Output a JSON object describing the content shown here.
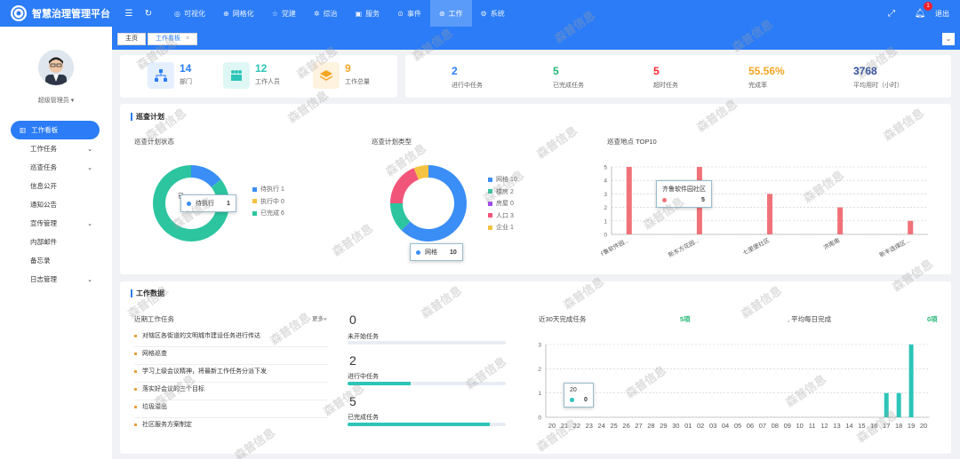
{
  "app": {
    "title": "智慧治理管理平台"
  },
  "nav": [
    {
      "icon": "eye-icon",
      "label": "可视化"
    },
    {
      "icon": "grid-icon",
      "label": "网格化"
    },
    {
      "icon": "star-icon",
      "label": "党建"
    },
    {
      "icon": "settings-icon",
      "label": "综治"
    },
    {
      "icon": "book-icon",
      "label": "服务"
    },
    {
      "icon": "location-icon",
      "label": "事件"
    },
    {
      "icon": "work-icon",
      "label": "工作"
    },
    {
      "icon": "gear-icon",
      "label": "系统"
    }
  ],
  "header": {
    "notification_count": "1",
    "logout": "退出"
  },
  "user": {
    "name": "超级管理员"
  },
  "sidebar": {
    "items": [
      {
        "label": "工作看板"
      },
      {
        "label": "工作任务"
      },
      {
        "label": "巡查任务"
      },
      {
        "label": "信息公开"
      },
      {
        "label": "通知公告"
      },
      {
        "label": "宣传管理"
      },
      {
        "label": "内部邮件"
      },
      {
        "label": "备忘录"
      },
      {
        "label": "日志管理"
      }
    ]
  },
  "tabs": [
    {
      "label": "主页"
    },
    {
      "label": "工作看板"
    }
  ],
  "stats": [
    {
      "value": "14",
      "label": "部门",
      "color": "#2b7cf6"
    },
    {
      "value": "12",
      "label": "工作人员",
      "color": "#2cc5b8"
    },
    {
      "value": "9",
      "label": "工作总量",
      "color": "#f5a623"
    }
  ],
  "kpis": [
    {
      "value": "2",
      "label": "进行中任务",
      "color": "#2b7cf6"
    },
    {
      "value": "5",
      "label": "已完成任务",
      "color": "#22b573"
    },
    {
      "value": "5",
      "label": "超时任务",
      "color": "#f5222d"
    },
    {
      "value": "55.56%",
      "label": "完成率",
      "color": "#f5a623"
    },
    {
      "value": "3768",
      "label": "平均用时（小时）",
      "color": "#2b4a9c"
    }
  ],
  "patrol": {
    "title": "巡查计划",
    "status_title": "巡查计划状态",
    "type_title": "巡查计划类型",
    "top_title": "巡查地点 TOP10",
    "status_tooltip": {
      "label": "待执行",
      "value": "1"
    },
    "type_tooltip": {
      "label": "网格",
      "value": "10"
    },
    "top_tooltip": {
      "label": "齐鲁软件园社区",
      "value": "5"
    },
    "status_partial_label": "已"
  },
  "work": {
    "title": "工作数据",
    "recent_title": "近期工作任务",
    "more": "更多",
    "tasks": [
      "对辖区各街道的文明城市建设任务进行传达",
      "网格巡查",
      "学习上级会议精神，将最新工作任务分派下发",
      "落实好会议的三个目标",
      "垃圾溢出",
      "社区服务方案制定"
    ],
    "progress": [
      {
        "value": "0",
        "label": "未开始任务",
        "fraction": 0
      },
      {
        "value": "2",
        "label": "进行中任务",
        "fraction": 0.4
      },
      {
        "value": "5",
        "label": "已完成任务",
        "fraction": 0.9
      }
    ],
    "chart_title": "近30天完成任务",
    "chart_total": "5项",
    "avg_title": "平均每日完成",
    "avg_value": "0项",
    "daily_tooltip": {
      "label": "20",
      "value": "0"
    }
  },
  "watermark": "森普信息",
  "chart_data": [
    {
      "type": "pie",
      "title": "巡查计划状态",
      "categories": [
        "待执行",
        "执行中",
        "已完成"
      ],
      "values": [
        1,
        0,
        6
      ],
      "colors": [
        "#3a8ef6",
        "#f5c342",
        "#2cc5a0"
      ]
    },
    {
      "type": "pie",
      "title": "巡查计划类型",
      "categories": [
        "网格",
        "楼房",
        "房屋",
        "人口",
        "企业"
      ],
      "values": [
        10,
        2,
        0,
        3,
        1
      ],
      "colors": [
        "#3a8ef6",
        "#2cc5a0",
        "#a04ce6",
        "#f2557a",
        "#f5c342"
      ]
    },
    {
      "type": "bar",
      "title": "巡查地点 TOP10",
      "categories": [
        "齐鲁软件园...",
        "",
        "新东方花园...",
        "",
        "七里堡社区",
        "",
        "洪南南",
        "",
        "新丰选煤区..."
      ],
      "values": [
        5,
        0,
        5,
        0,
        3,
        0,
        2,
        0,
        1
      ],
      "ylim": [
        0,
        5
      ],
      "yticks": [
        0,
        1,
        2,
        3,
        4,
        5
      ],
      "color": "#f07279"
    },
    {
      "type": "bar",
      "title": "近30天完成任务",
      "categories": [
        "20",
        "21",
        "22",
        "23",
        "24",
        "25",
        "26",
        "27",
        "28",
        "29",
        "30",
        "01",
        "02",
        "03",
        "04",
        "05",
        "06",
        "07",
        "08",
        "09",
        "10",
        "11",
        "12",
        "13",
        "14",
        "15",
        "16",
        "17",
        "18",
        "19",
        "20"
      ],
      "values": [
        0,
        0,
        0,
        0,
        0,
        0,
        0,
        0,
        0,
        0,
        0,
        0,
        0,
        0,
        0,
        0,
        0,
        0,
        0,
        0,
        0,
        0,
        0,
        0,
        0,
        0,
        0,
        1,
        1,
        3,
        0
      ],
      "ylim": [
        0,
        3
      ],
      "yticks": [
        0,
        1,
        2,
        3
      ],
      "color": "#2cc5b8"
    }
  ]
}
